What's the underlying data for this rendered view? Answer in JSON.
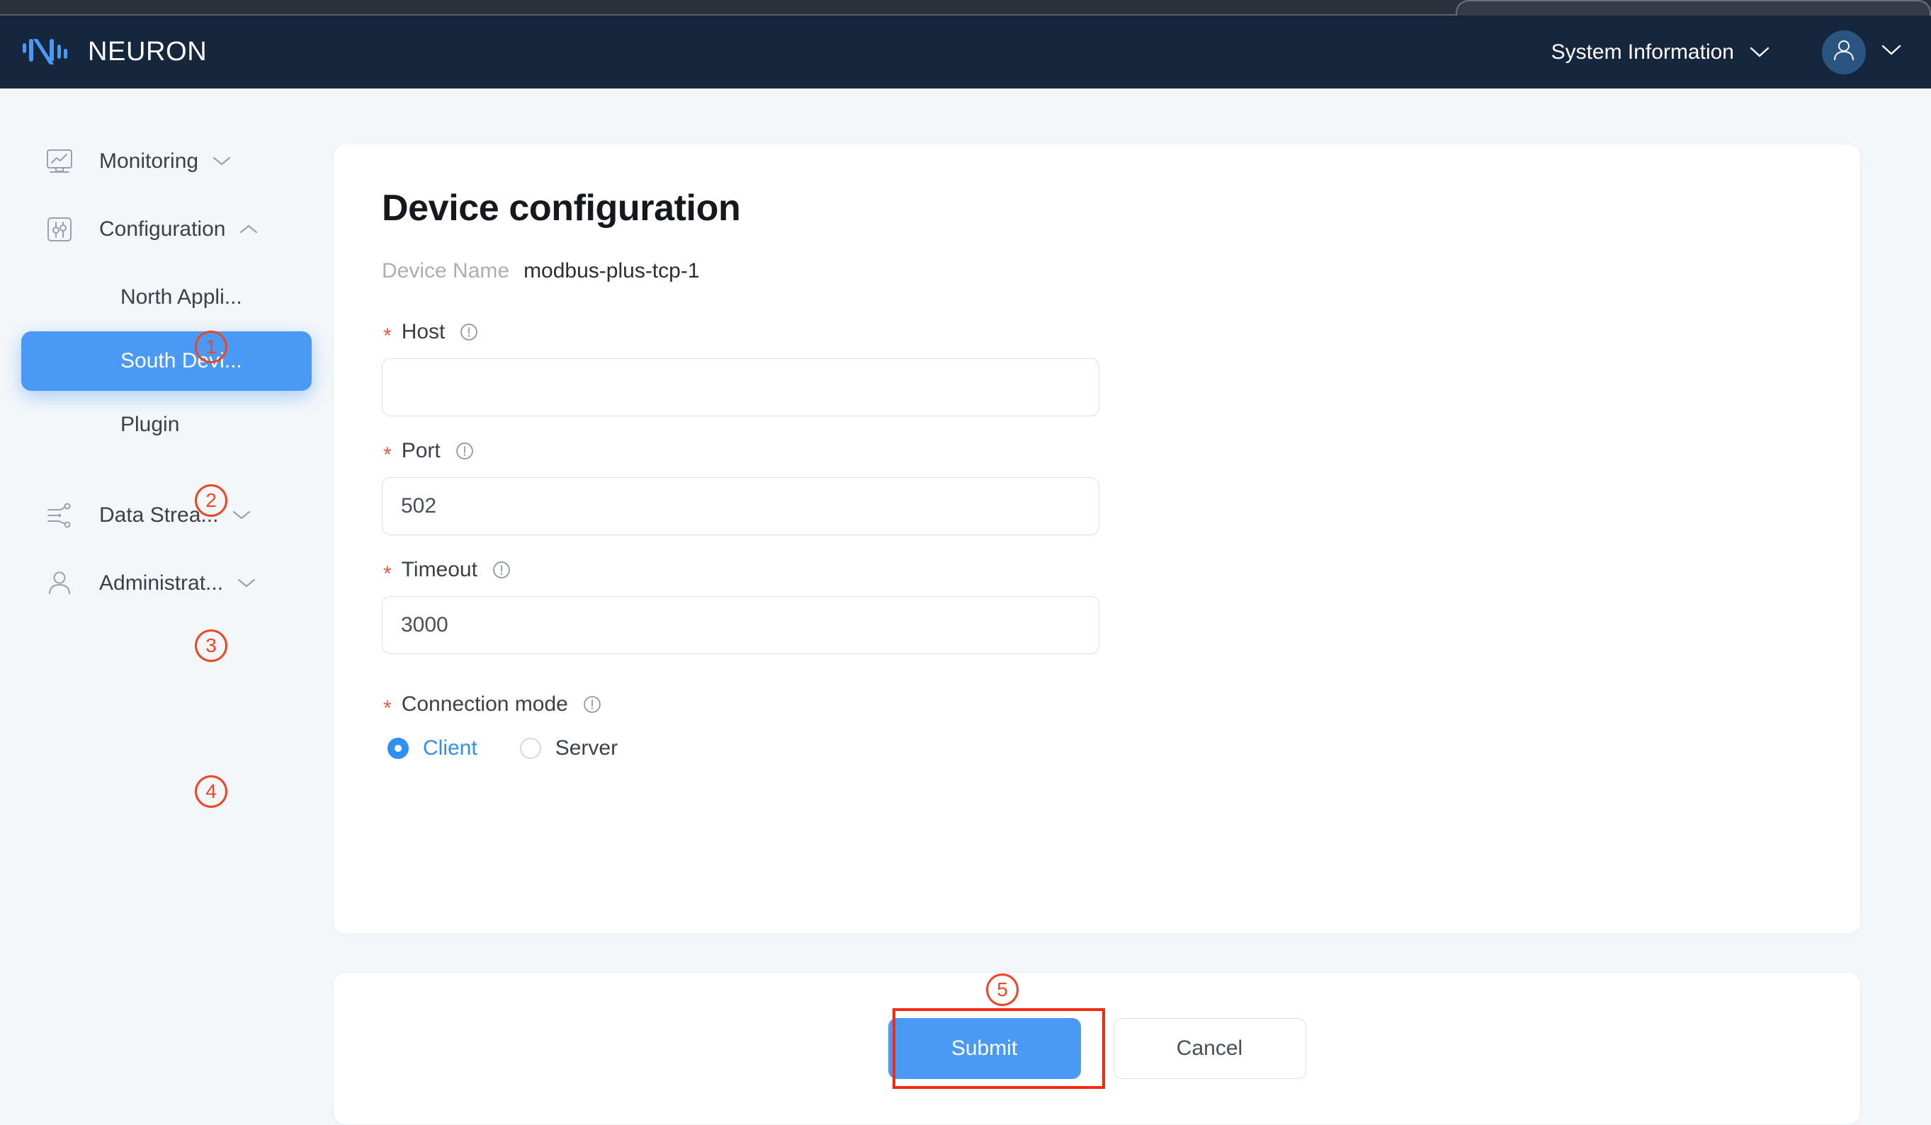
{
  "header": {
    "brand_name": "NEURON",
    "brand_logo_icon": "neuron-logo-icon",
    "system_information_label": "System Information",
    "system_information_chevron_icon": "chevron-down-icon",
    "avatar_icon": "user-avatar-icon",
    "avatar_chevron_icon": "chevron-down-icon",
    "colors": {
      "header_bg": "#16263c",
      "avatar_bg": "#2a5580"
    }
  },
  "sidebar": {
    "items": [
      {
        "label": "Monitoring",
        "icon": "monitor-chart-icon",
        "chevron": "chevron-down-icon",
        "type": "group",
        "expanded": false
      },
      {
        "label": "Configuration",
        "icon": "sliders-square-icon",
        "chevron": "chevron-up-icon",
        "type": "group",
        "expanded": true
      },
      {
        "label": "North Appli...",
        "type": "sub",
        "active": false
      },
      {
        "label": "South Devi...",
        "type": "sub",
        "active": true
      },
      {
        "label": "Plugin",
        "type": "sub",
        "active": false
      },
      {
        "label": "Data Strea...",
        "icon": "data-stream-icon",
        "chevron": "chevron-down-icon",
        "type": "group",
        "expanded": false
      },
      {
        "label": "Administrat...",
        "icon": "user-icon",
        "chevron": "chevron-down-icon",
        "type": "group",
        "expanded": false
      }
    ],
    "active_color": "#4a9af5"
  },
  "main": {
    "page_title": "Device configuration",
    "device_name_label": "Device Name",
    "device_name_value": "modbus-plus-tcp-1",
    "fields": [
      {
        "label": "Host",
        "required": true,
        "info_icon": "info-circle-icon",
        "value": "",
        "placeholder": "",
        "type": "text"
      },
      {
        "label": "Port",
        "required": true,
        "info_icon": "info-circle-icon",
        "value": "502",
        "placeholder": "",
        "type": "text"
      },
      {
        "label": "Timeout",
        "required": true,
        "info_icon": "info-circle-icon",
        "value": "3000",
        "placeholder": "",
        "type": "text"
      },
      {
        "label": "Connection mode",
        "required": true,
        "info_icon": "info-circle-icon",
        "type": "radio",
        "options": [
          {
            "label": "Client",
            "selected": true
          },
          {
            "label": "Server",
            "selected": false
          }
        ]
      }
    ]
  },
  "footer": {
    "submit_label": "Submit",
    "cancel_label": "Cancel",
    "submit_color": "#4a9af5"
  },
  "annotations": {
    "highlight_color": "#f32b12",
    "marker_color": "#ee4622",
    "markers": [
      {
        "number": "1",
        "target": "host-field"
      },
      {
        "number": "2",
        "target": "port-field"
      },
      {
        "number": "3",
        "target": "timeout-field"
      },
      {
        "number": "4",
        "target": "connection-mode-field"
      },
      {
        "number": "5",
        "target": "submit-button"
      }
    ]
  }
}
